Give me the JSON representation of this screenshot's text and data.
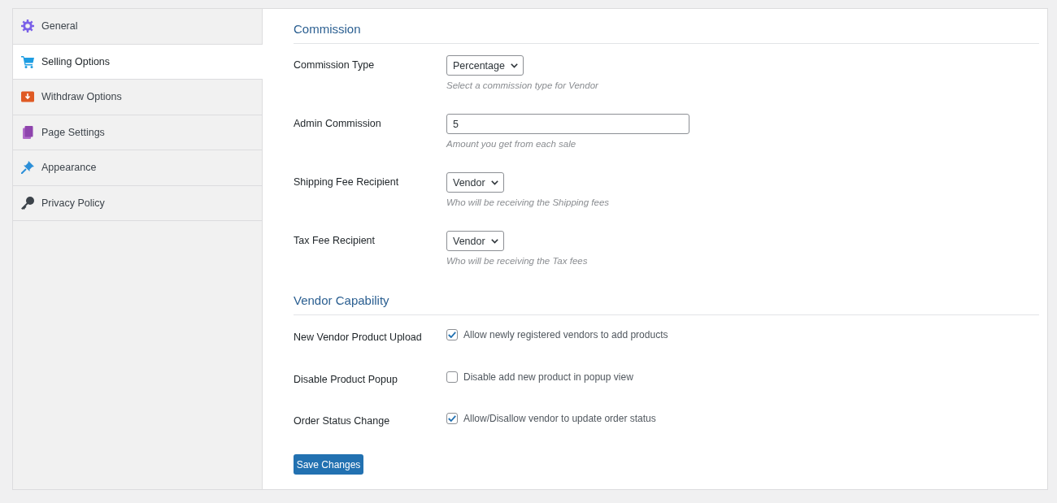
{
  "sidebar": {
    "items": [
      {
        "label": "General",
        "selected": false
      },
      {
        "label": "Selling Options",
        "selected": true
      },
      {
        "label": "Withdraw Options",
        "selected": false
      },
      {
        "label": "Page Settings",
        "selected": false
      },
      {
        "label": "Appearance",
        "selected": false
      },
      {
        "label": "Privacy Policy",
        "selected": false
      }
    ]
  },
  "sections": [
    {
      "title": "Commission",
      "fields": [
        {
          "kind": "select",
          "label": "Commission Type",
          "value": "Percentage",
          "description": "Select a commission type for Vendor"
        },
        {
          "kind": "text",
          "label": "Admin Commission",
          "value": "5",
          "description": "Amount you get from each sale"
        },
        {
          "kind": "select",
          "label": "Shipping Fee Recipient",
          "value": "Vendor",
          "description": "Who will be receiving the Shipping fees"
        },
        {
          "kind": "select",
          "label": "Tax Fee Recipient",
          "value": "Vendor",
          "description": "Who will be receiving the Tax fees"
        }
      ]
    },
    {
      "title": "Vendor Capability",
      "fields": [
        {
          "kind": "checkbox",
          "label": "New Vendor Product Upload",
          "checked": true,
          "text": "Allow newly registered vendors to add products"
        },
        {
          "kind": "checkbox",
          "label": "Disable Product Popup",
          "checked": false,
          "text": "Disable add new product in popup view"
        },
        {
          "kind": "checkbox",
          "label": "Order Status Change",
          "checked": true,
          "text": "Allow/Disallow vendor to update order status"
        }
      ]
    }
  ],
  "save_button": {
    "label": "Save Changes"
  }
}
